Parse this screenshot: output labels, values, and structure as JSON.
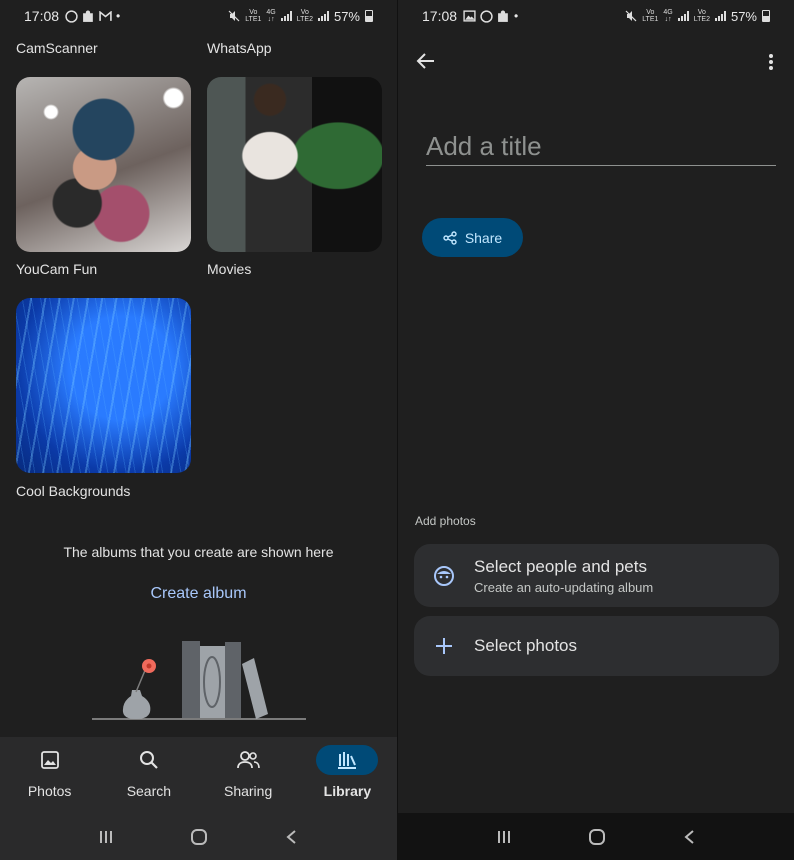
{
  "left": {
    "status": {
      "time": "17:08",
      "battery": "57%"
    },
    "top_labels": [
      "CamScanner",
      "WhatsApp"
    ],
    "albums": [
      {
        "name": "YouCam Fun"
      },
      {
        "name": "Movies"
      },
      {
        "name": "Cool Backgrounds"
      }
    ],
    "empty_text": "The albums that you create are shown here",
    "create_album": "Create album",
    "nav": [
      {
        "label": "Photos",
        "icon": "photo-icon"
      },
      {
        "label": "Search",
        "icon": "search-icon"
      },
      {
        "label": "Sharing",
        "icon": "people-icon"
      },
      {
        "label": "Library",
        "icon": "library-icon",
        "active": true
      }
    ]
  },
  "right": {
    "status": {
      "time": "17:08",
      "battery": "57%"
    },
    "title_placeholder": "Add a title",
    "share_label": "Share",
    "add_photos_label": "Add photos",
    "options": [
      {
        "title": "Select people and pets",
        "subtitle": "Create an auto-updating album",
        "icon": "face-icon"
      },
      {
        "title": "Select photos",
        "icon": "plus-icon"
      }
    ]
  },
  "colors": {
    "accent": "#a8c7fa",
    "active_pill": "#004a77",
    "background": "#1f1f1f"
  }
}
